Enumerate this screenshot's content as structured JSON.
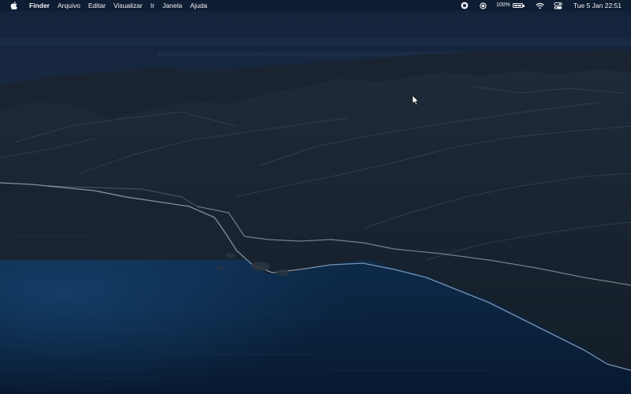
{
  "menubar": {
    "apple_icon": "apple-logo-icon",
    "app_name": "Finder",
    "menus": [
      "Arquivo",
      "Editar",
      "Visualizar",
      "Ir",
      "Janela",
      "Ajuda"
    ],
    "status": {
      "icons": [
        "screen-record-icon",
        "focus-icon",
        "wifi-icon",
        "control-center-icon"
      ],
      "battery_percent": "100%",
      "battery_level": 1.0,
      "charging": true,
      "clock": "Tue 5 Jan  22:51"
    }
  },
  "desktop": {
    "wallpaper": "macOS Big Sur coastline at night"
  },
  "colors": {
    "menubar_bg": "#0e1c30",
    "menubar_text": "#f2f4f7",
    "sky": "#14243a",
    "ocean": "#0c2746",
    "mountains": "#1b2633"
  }
}
